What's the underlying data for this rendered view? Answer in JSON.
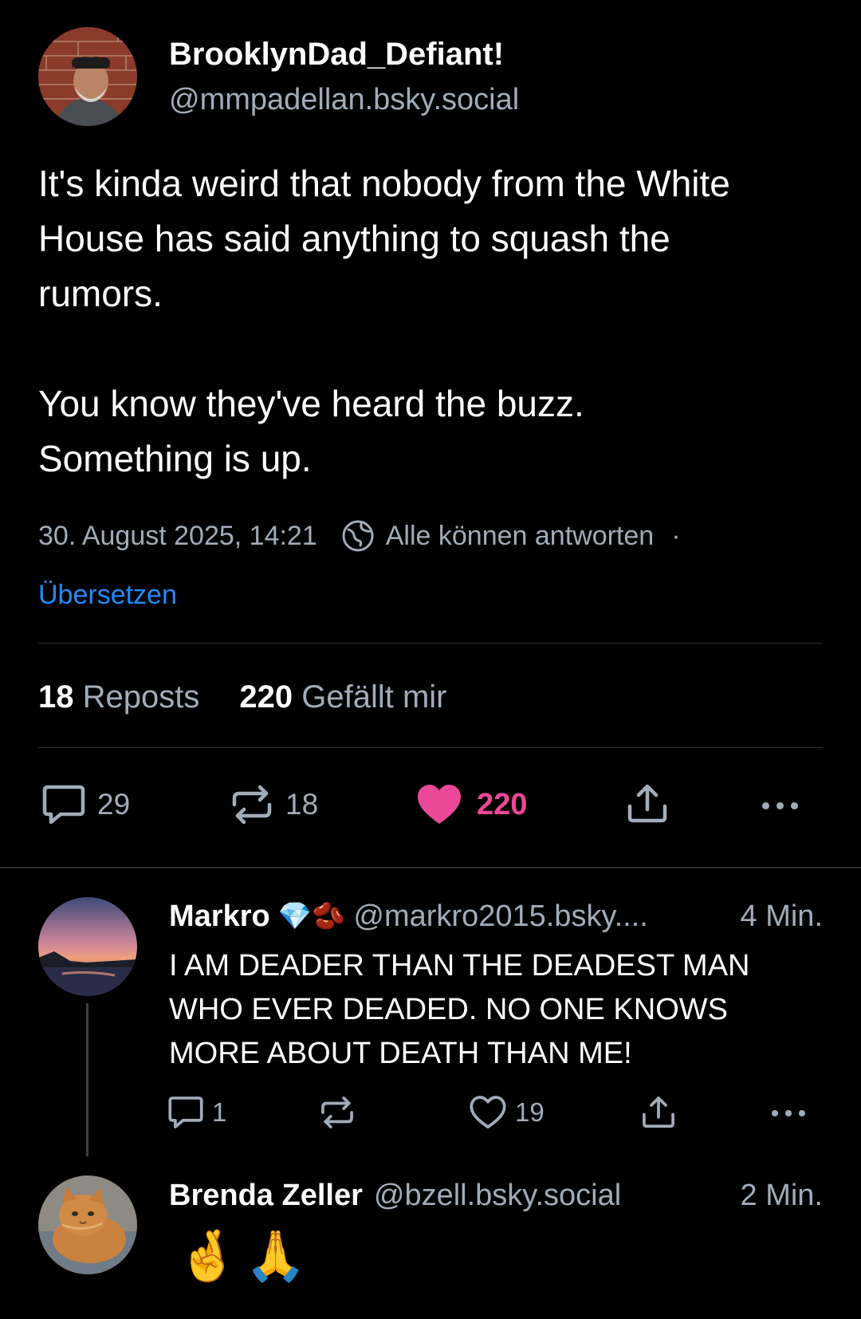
{
  "main_post": {
    "author": {
      "display_name": "BrooklynDad_Defiant!",
      "handle": "@mmpadellan.bsky.social"
    },
    "text_paragraphs": [
      "It's kinda weird that nobody from the White House has said anything to squash the rumors.",
      "You know they've heard the buzz. Something is up."
    ],
    "timestamp": "30. August 2025, 14:21",
    "reply_setting": "Alle können antworten",
    "separator": "·",
    "translate_label": "Übersetzen",
    "stats": {
      "reposts_count": "18",
      "reposts_label": "Reposts",
      "likes_count": "220",
      "likes_label": "Gefällt mir"
    },
    "actions": {
      "reply_count": "29",
      "repost_count": "18",
      "like_count": "220",
      "liked": true
    }
  },
  "replies": [
    {
      "display_name": "Markro",
      "badges": [
        "💎",
        "🫘"
      ],
      "handle": "@markro2015.bsky....",
      "time": "4 Min.",
      "text": "I AM DEADER THAN THE DEADEST MAN WHO EVER DEADED.  NO ONE KNOWS MORE ABOUT DEATH THAN ME!",
      "actions": {
        "reply_count": "1",
        "repost_count": "",
        "like_count": "19"
      }
    },
    {
      "display_name": "Brenda Zeller",
      "handle": "@bzell.bsky.social",
      "time": "2 Min.",
      "text": "🤞🙏"
    }
  ],
  "colors": {
    "background": "#000000",
    "text": "#ffffff",
    "muted": "#a2acb8",
    "link": "#208bfe",
    "like": "#ec4899",
    "divider": "#2a2e33"
  },
  "icons": {
    "reply": "speech-bubble-icon",
    "repost": "repost-arrows-icon",
    "like": "heart-icon",
    "share": "share-upload-icon",
    "more": "more-dots-icon",
    "reply_setting": "globe-icon"
  }
}
